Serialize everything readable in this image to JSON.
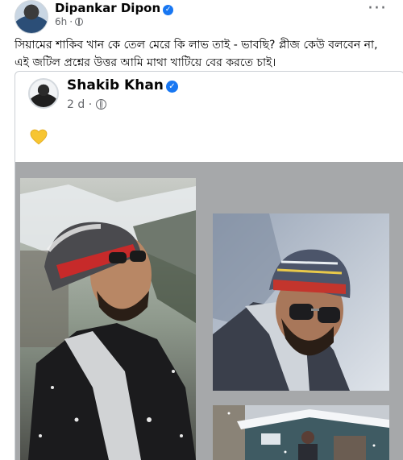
{
  "post": {
    "author_name": "Dipankar Dipon",
    "time": "6h",
    "audience_icon": "globe-icon",
    "more_icon": "more-horizontal-icon",
    "more_label": "···",
    "caption": "সিয়ামের শাকিব খান কে তেল মেরে কি লাভ তাই - ভাবছি? প্লীজ কেউ বলবেন না, এই জটিল প্রশ্নের উত্তর আমি মাথা খাটিয়ে বের করতে চাই।"
  },
  "shared_post": {
    "author_name": "Shakib Khan",
    "time": "2 d",
    "audience_icon": "globe-icon",
    "emoji": "yellow-heart-emoji",
    "photos": [
      {
        "name": "photo-snow-portrait"
      },
      {
        "name": "photo-sunglasses-closeup"
      },
      {
        "name": "photo-snow-cabin"
      }
    ]
  },
  "colors": {
    "verified_badge": "#1877f2",
    "secondary_text": "#65676b",
    "gallery_bg": "#a6a8aa",
    "heart": "#f7c531"
  }
}
